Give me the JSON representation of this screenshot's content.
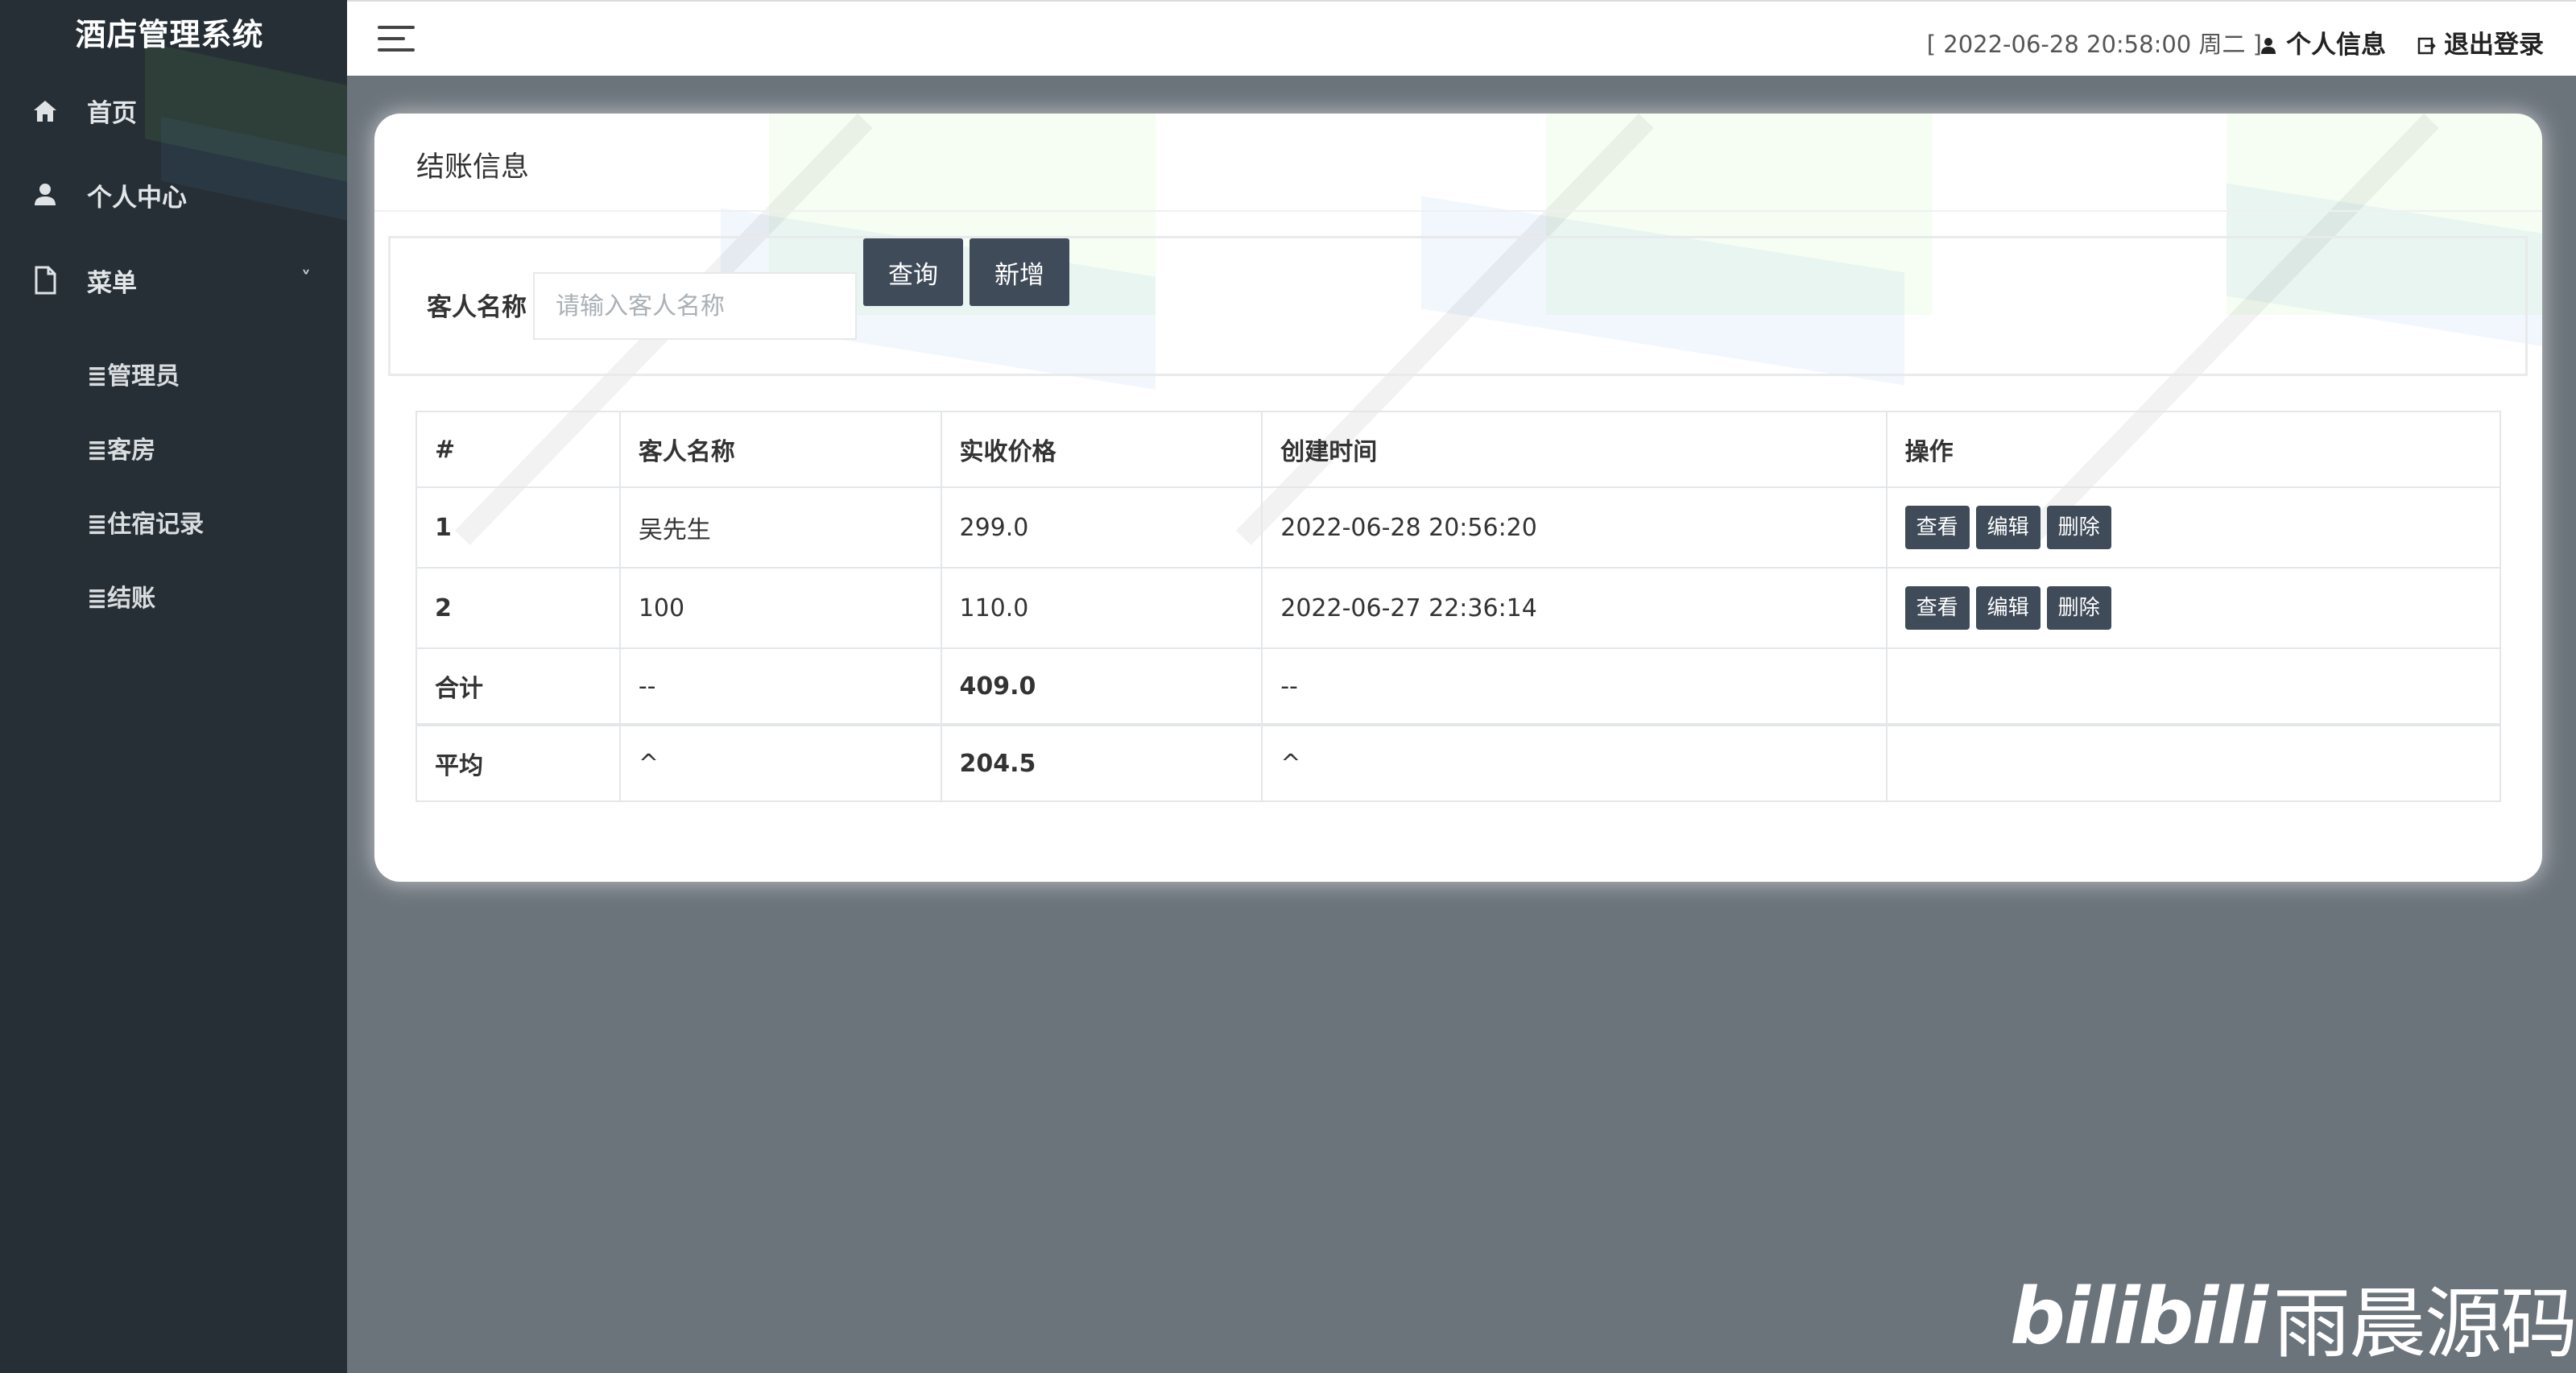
{
  "sidebar": {
    "brand": "酒店管理系统",
    "items": [
      {
        "label": "首页",
        "icon": "home-icon"
      },
      {
        "label": "个人中心",
        "icon": "user-icon"
      },
      {
        "label": "菜单",
        "icon": "document-icon",
        "chevron": "˅"
      }
    ],
    "submenu": [
      {
        "label": "≣管理员"
      },
      {
        "label": "≣客房"
      },
      {
        "label": "≣住宿记录"
      },
      {
        "label": "≣结账"
      }
    ]
  },
  "topbar": {
    "datetime": "[ 2022-06-28 20:58:00 周二 ]",
    "profile_label": "个人信息",
    "logout_label": "退出登录"
  },
  "card": {
    "title": "结账信息"
  },
  "search": {
    "label": "客人名称",
    "placeholder": "请输入客人名称",
    "value": "",
    "query_button": "查询",
    "add_button": "新增"
  },
  "table": {
    "headers": [
      "#",
      "客人名称",
      "实收价格",
      "创建时间",
      "操作"
    ],
    "rows": [
      {
        "no": "1",
        "name": "吴先生",
        "price": "299.0",
        "created": "2022-06-28 20:56:20"
      },
      {
        "no": "2",
        "name": "100",
        "price": "110.0",
        "created": "2022-06-27 22:36:14"
      }
    ],
    "actions": {
      "view": "查看",
      "edit": "编辑",
      "delete": "删除"
    },
    "sum_row": {
      "label": "合计",
      "name": "--",
      "price": "409.0",
      "created": "--"
    },
    "avg_row": {
      "label": "平均",
      "name": "^",
      "price": "204.5",
      "created": "^"
    }
  },
  "watermark": {
    "logo": "bilibili",
    "text": "雨晨源码"
  },
  "colors": {
    "sidebar_bg": "#262f35",
    "main_bg": "#6b737b",
    "button_bg": "#3f4b59",
    "card_bg": "#ffffff"
  }
}
